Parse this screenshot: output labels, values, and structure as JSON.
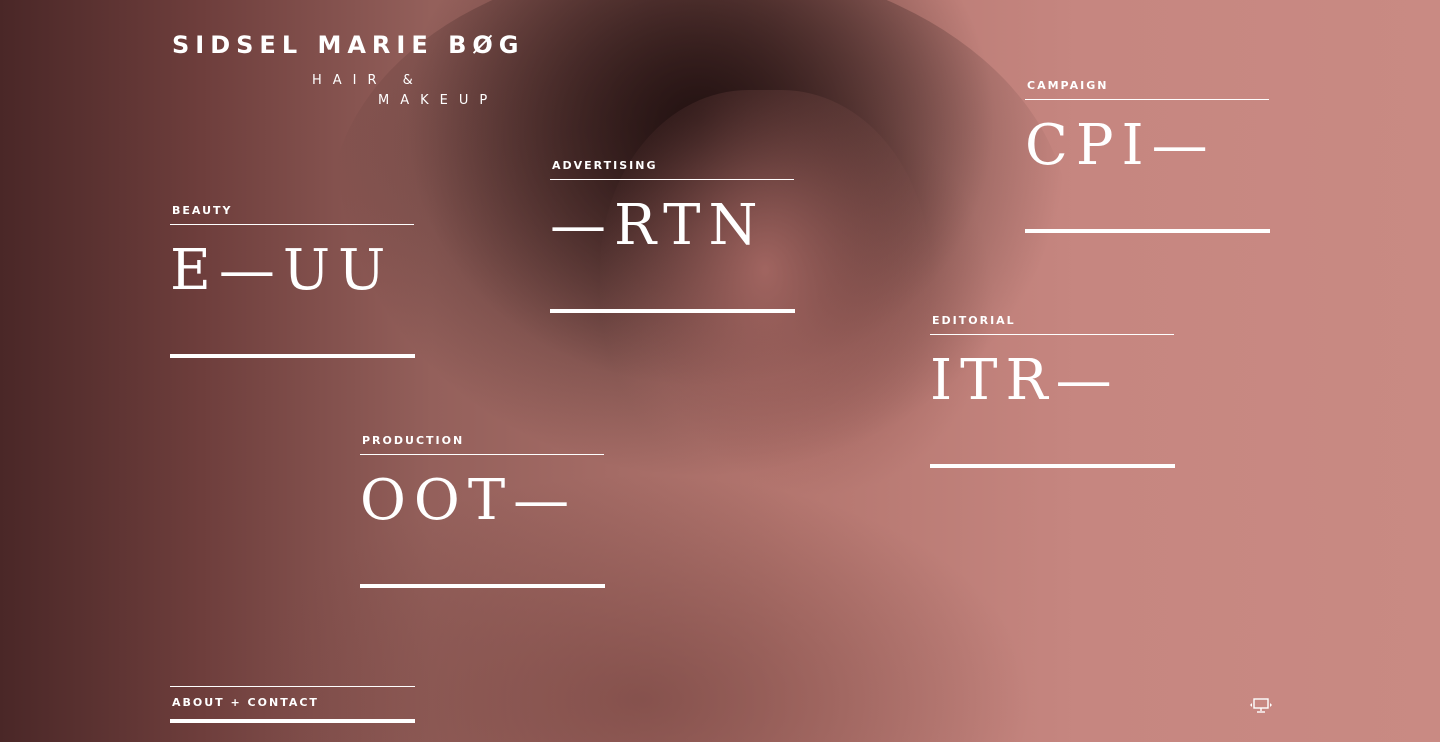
{
  "brand": {
    "name": "SIDSEL MARIE BØG",
    "sub_line1": "HAIR &",
    "sub_line2": "MAKEUP"
  },
  "categories": [
    {
      "id": "beauty",
      "label": "BEAUTY",
      "text": "E—UU"
    },
    {
      "id": "advertising",
      "label": "ADVERTISING",
      "text": "—RTN"
    },
    {
      "id": "campaign",
      "label": "CAMPAIGN",
      "text": "CPI—"
    },
    {
      "id": "editorial",
      "label": "EDITORIAL",
      "text": "ITR—"
    },
    {
      "id": "production",
      "label": "PRODUCTION",
      "text": "OOT—"
    }
  ],
  "footer": {
    "about_label": "ABOUT + CONTACT",
    "device_icon": "monitor-icon"
  }
}
